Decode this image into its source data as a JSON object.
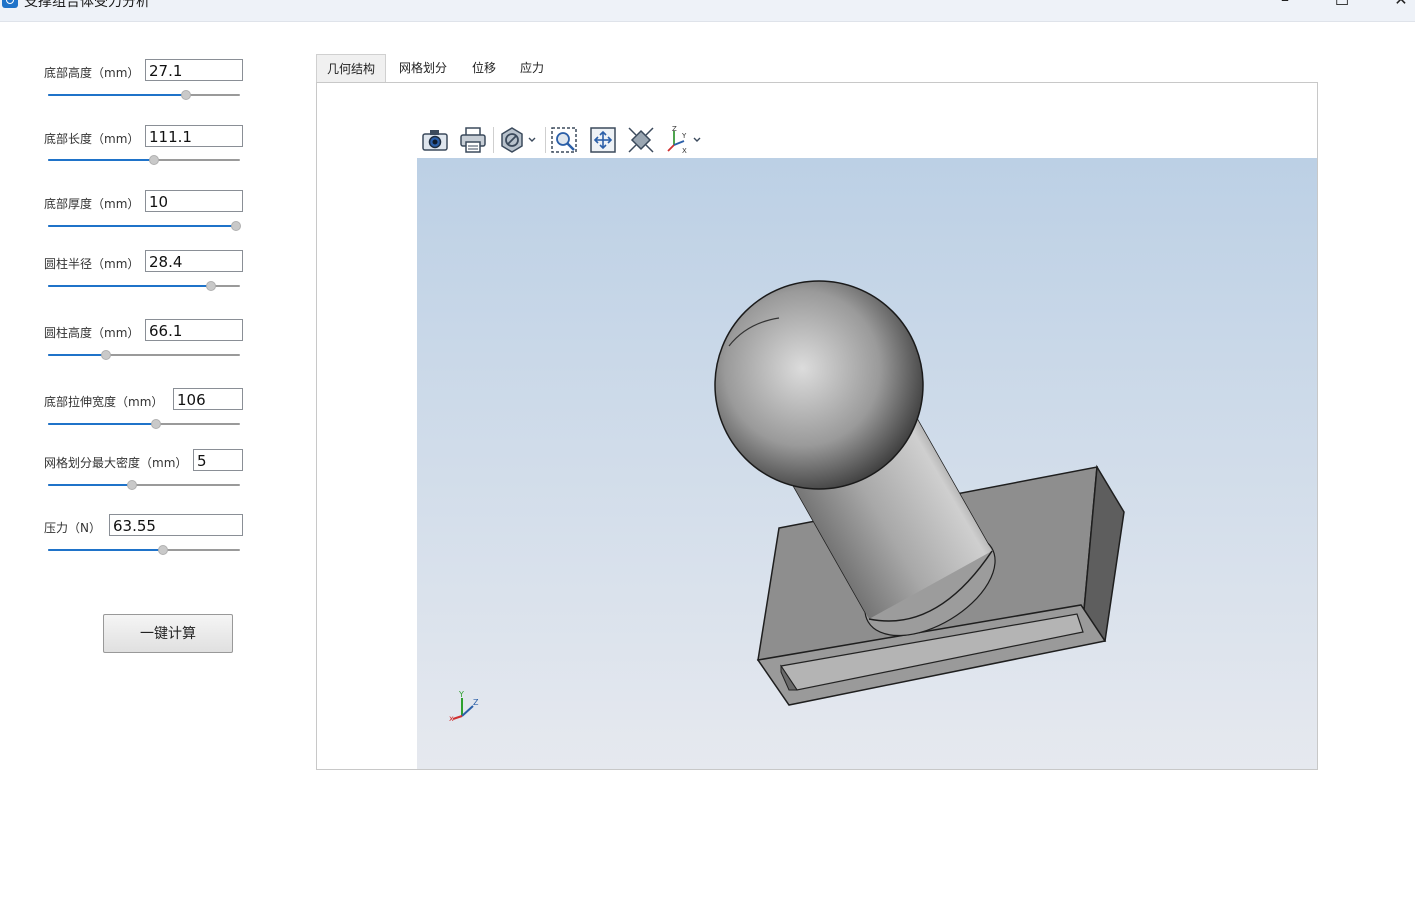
{
  "window": {
    "title": "支撑组合体受力分析",
    "controls": {
      "minimize": "–",
      "maximize": "☐",
      "close": "✕"
    }
  },
  "params": [
    {
      "label": "底部高度（mm）",
      "value": "27.1",
      "slider": 0.72
    },
    {
      "label": "底部长度（mm）",
      "value": "111.1",
      "slider": 0.55
    },
    {
      "label": "底部厚度（mm）",
      "value": "10",
      "slider": 0.98
    },
    {
      "label": "圆柱半径（mm）",
      "value": "28.4",
      "slider": 0.85
    },
    {
      "label": "圆柱高度（mm）",
      "value": "66.1",
      "slider": 0.3
    },
    {
      "label": "底部拉伸宽度（mm）",
      "value": "106",
      "slider": 0.56
    },
    {
      "label": "网格划分最大密度（mm）",
      "value": "5",
      "slider": 0.44
    },
    {
      "label": "压力（N）",
      "value": "63.55",
      "slider": 0.6
    }
  ],
  "calc_button": "一键计算",
  "tabs": [
    "几何结构",
    "网格划分",
    "位移",
    "应力"
  ],
  "active_tab": 0,
  "toolbar_icons": [
    "camera-icon",
    "print-icon",
    "hide-icon",
    "zoom-box-icon",
    "fit-all-icon",
    "view-direction-icon",
    "axis-icon"
  ],
  "axis_labels": {
    "x": "x",
    "y": "Y",
    "z": "Z"
  },
  "colors": {
    "accent": "#1f73c9",
    "viewport_top": "#bcd0e5",
    "viewport_bottom": "#e6e9ef"
  }
}
